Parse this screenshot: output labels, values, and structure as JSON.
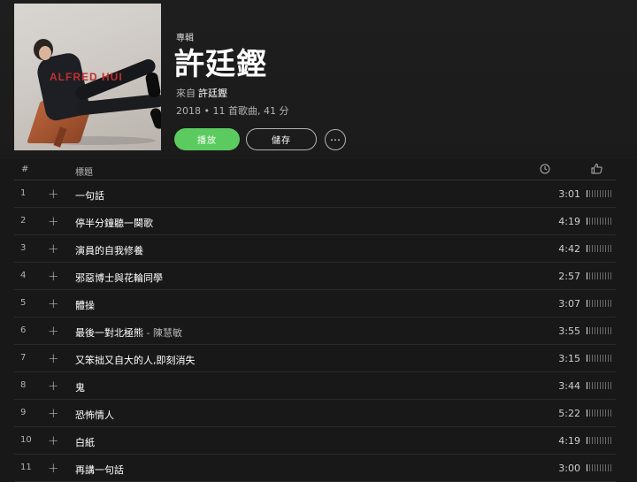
{
  "album": {
    "type_label": "專輯",
    "title": "許廷鏗",
    "by_prefix": "來自",
    "artist": "許廷鏗",
    "meta": "2018 • 11 首歌曲, 41 分",
    "cover_text": "ALFRED HUI",
    "cover_top": [
      "",
      "",
      ""
    ]
  },
  "buttons": {
    "play": "播放",
    "save": "儲存",
    "more": "⋯"
  },
  "table": {
    "col_num": "#",
    "col_title": "標題",
    "col_duration_icon": "clock-icon",
    "col_popularity_icon": "thumbs-up-icon"
  },
  "tracks": [
    {
      "num": "1",
      "title": "一句話",
      "featured": "",
      "duration": "3:01",
      "popularity": 1
    },
    {
      "num": "2",
      "title": "停半分鐘聽一闋歌",
      "featured": "",
      "duration": "4:19",
      "popularity": 1
    },
    {
      "num": "3",
      "title": "演員的自我修養",
      "featured": "",
      "duration": "4:42",
      "popularity": 1
    },
    {
      "num": "4",
      "title": "邪惡博士與花輪同學",
      "featured": "",
      "duration": "2:57",
      "popularity": 1
    },
    {
      "num": "5",
      "title": "體操",
      "featured": "",
      "duration": "3:07",
      "popularity": 1
    },
    {
      "num": "6",
      "title": "最後一對北極熊",
      "featured": "陳慧敏",
      "duration": "3:55",
      "popularity": 1
    },
    {
      "num": "7",
      "title": "又笨拙又自大的人,即刻消失",
      "featured": "",
      "duration": "3:15",
      "popularity": 1
    },
    {
      "num": "8",
      "title": "鬼",
      "featured": "",
      "duration": "3:44",
      "popularity": 1
    },
    {
      "num": "9",
      "title": "恐怖情人",
      "featured": "",
      "duration": "5:22",
      "popularity": 1
    },
    {
      "num": "10",
      "title": "白紙",
      "featured": "",
      "duration": "4:19",
      "popularity": 1
    },
    {
      "num": "11",
      "title": "再講一句話",
      "featured": "",
      "duration": "3:00",
      "popularity": 1
    }
  ],
  "colors": {
    "background": "#181818",
    "play_button": "#5ccb5f",
    "secondary_text": "#b3b3b3"
  }
}
